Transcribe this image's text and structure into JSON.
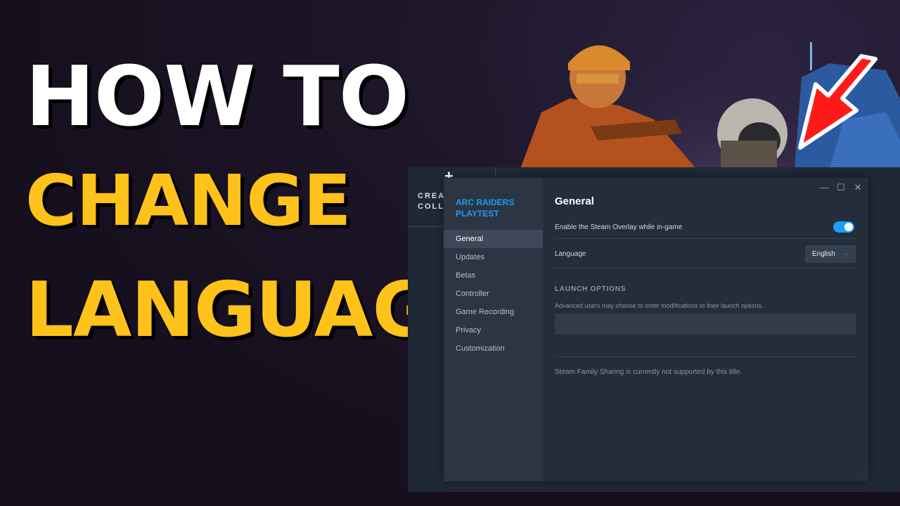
{
  "headline": {
    "line1": "HOW TO",
    "line2": "CHANGE",
    "line3": "LANGUAGE"
  },
  "collection": {
    "plus": "+",
    "label": "CREATE A NEW COLLECTION"
  },
  "dialog": {
    "game_title": "ARC RAIDERS PLAYTEST",
    "window_controls": {
      "minimize": "—",
      "maximize": "☐",
      "close": "✕"
    },
    "nav": [
      {
        "label": "General",
        "active": true
      },
      {
        "label": "Updates"
      },
      {
        "label": "Betas"
      },
      {
        "label": "Controller"
      },
      {
        "label": "Game Recording"
      },
      {
        "label": "Privacy"
      },
      {
        "label": "Customization"
      }
    ],
    "section_title": "General",
    "overlay": {
      "label": "Enable the Steam Overlay while in-game",
      "enabled": true
    },
    "language": {
      "label": "Language",
      "value": "English"
    },
    "launch_options": {
      "heading": "LAUNCH OPTIONS",
      "help": "Advanced users may choose to enter modifications to their launch options.",
      "value": ""
    },
    "family_note": "Steam Family Sharing is currently not supported by this title.",
    "resize_glyph": "⋰"
  },
  "colors": {
    "accent": "#1a9fff",
    "headline_yellow": "#ffc21a",
    "arrow_red": "#ff1a1a"
  }
}
